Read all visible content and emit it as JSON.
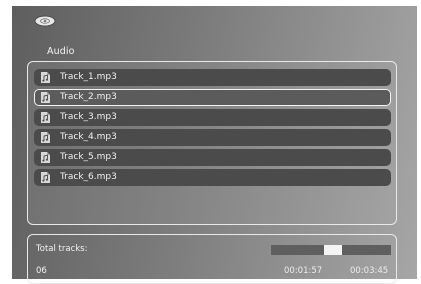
{
  "header": {
    "icon": "disc-icon",
    "title": "Audio"
  },
  "playlist": {
    "selected_index": 1,
    "items": [
      {
        "label": "Track_1.mp3",
        "icon": "audio-file-icon"
      },
      {
        "label": "Track_2.mp3",
        "icon": "audio-file-icon"
      },
      {
        "label": "Track_3.mp3",
        "icon": "audio-file-icon"
      },
      {
        "label": "Track_4.mp3",
        "icon": "audio-file-icon"
      },
      {
        "label": "Track_5.mp3",
        "icon": "audio-file-icon"
      },
      {
        "label": "Track_6.mp3",
        "icon": "audio-file-icon"
      }
    ]
  },
  "status": {
    "total_label": "Total tracks:",
    "total_count": "06",
    "elapsed": "00:01:57",
    "duration": "00:03:45",
    "progress_fraction": 0.52
  },
  "colors": {
    "panel_dark": "#5e5e5e",
    "panel_light": "#a6a6a6",
    "row_bg": "#4b4b4b",
    "highlight": "#f2f2f2"
  }
}
